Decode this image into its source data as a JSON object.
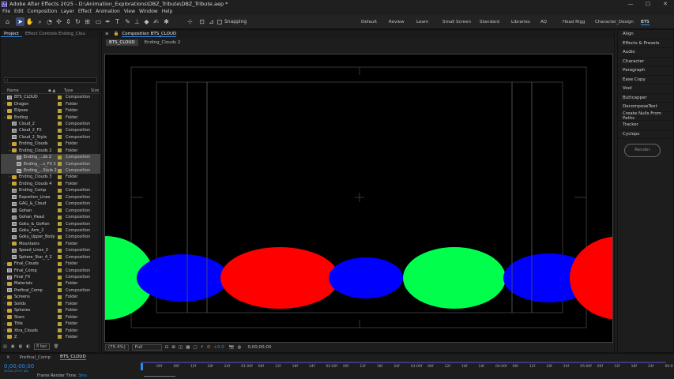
{
  "app": {
    "title": "Adobe After Effects 2025 - D:\\Animation_Explorations\\DBZ_Tribute\\DBZ_Tribute.aep *",
    "logo": "Ae",
    "window_controls": [
      "—",
      "☐",
      "✕"
    ]
  },
  "menu": [
    "File",
    "Edit",
    "Composition",
    "Layer",
    "Effect",
    "Animation",
    "View",
    "Window",
    "Help"
  ],
  "toolbar": {
    "snapping_label": "Snapping",
    "workspaces": [
      "Default",
      "Review",
      "Learn",
      "Small Screen",
      "Standard",
      "Libraries",
      "AQ",
      "Head Rigg",
      "Character_Design",
      "BTS"
    ],
    "active_workspace": "BTS"
  },
  "project": {
    "tabs": [
      "Project",
      "Effect Controls Ending_Clou"
    ],
    "search_placeholder": "",
    "columns": {
      "name": "Name",
      "type": "Type",
      "size": "Size"
    },
    "rows": [
      {
        "name": "BTS_CLOUD",
        "type": "Composition",
        "kind": "c",
        "indent": 0,
        "arrow": ""
      },
      {
        "name": "Dragon",
        "type": "Folder",
        "kind": "f",
        "indent": 0,
        "arrow": "›"
      },
      {
        "name": "Elipses",
        "type": "Folder",
        "kind": "f",
        "indent": 0,
        "arrow": "›"
      },
      {
        "name": "Ending",
        "type": "Folder",
        "kind": "f",
        "indent": 0,
        "arrow": "⌄"
      },
      {
        "name": "Cloud_2",
        "type": "Composition",
        "kind": "c",
        "indent": 1,
        "arrow": ""
      },
      {
        "name": "Cloud_2_FX",
        "type": "Composition",
        "kind": "c",
        "indent": 1,
        "arrow": ""
      },
      {
        "name": "Cloud_2_Style",
        "type": "Composition",
        "kind": "c",
        "indent": 1,
        "arrow": ""
      },
      {
        "name": "Ending_Clouds",
        "type": "Folder",
        "kind": "f",
        "indent": 1,
        "arrow": "›"
      },
      {
        "name": "Ending_Clouds 2",
        "type": "Folder",
        "kind": "f",
        "indent": 1,
        "arrow": "⌄"
      },
      {
        "name": "Ending_...ds 2",
        "type": "Composition",
        "kind": "c",
        "indent": 2,
        "arrow": "",
        "selected": true
      },
      {
        "name": "Ending_...s_FX 2",
        "type": "Composition",
        "kind": "c",
        "indent": 2,
        "arrow": "",
        "selected": true
      },
      {
        "name": "Ending_...Style 2",
        "type": "Composition",
        "kind": "c",
        "indent": 2,
        "arrow": "",
        "selected": true
      },
      {
        "name": "Ending_Clouds 3",
        "type": "Folder",
        "kind": "f",
        "indent": 1,
        "arrow": "›"
      },
      {
        "name": "Ending_Clouds 4",
        "type": "Folder",
        "kind": "f",
        "indent": 1,
        "arrow": "›"
      },
      {
        "name": "Ending_Comp",
        "type": "Composition",
        "kind": "c",
        "indent": 1,
        "arrow": ""
      },
      {
        "name": "Expretion_Lines",
        "type": "Composition",
        "kind": "c",
        "indent": 1,
        "arrow": ""
      },
      {
        "name": "GAG_&_Cloud",
        "type": "Composition",
        "kind": "c",
        "indent": 1,
        "arrow": ""
      },
      {
        "name": "Gohan",
        "type": "Composition",
        "kind": "c",
        "indent": 1,
        "arrow": ""
      },
      {
        "name": "Gohan_Head",
        "type": "Composition",
        "kind": "c",
        "indent": 1,
        "arrow": ""
      },
      {
        "name": "Goku_&_GoHan",
        "type": "Composition",
        "kind": "c",
        "indent": 1,
        "arrow": ""
      },
      {
        "name": "Goku_Arm_2",
        "type": "Composition",
        "kind": "c",
        "indent": 1,
        "arrow": ""
      },
      {
        "name": "Goku_Upper_Body",
        "type": "Composition",
        "kind": "c",
        "indent": 1,
        "arrow": ""
      },
      {
        "name": "Mountains",
        "type": "Folder",
        "kind": "f",
        "indent": 1,
        "arrow": "›"
      },
      {
        "name": "Speed_Lines_2",
        "type": "Composition",
        "kind": "c",
        "indent": 1,
        "arrow": ""
      },
      {
        "name": "Sphere_Star_4_2",
        "type": "Composition",
        "kind": "c",
        "indent": 1,
        "arrow": ""
      },
      {
        "name": "Final_Clouds",
        "type": "Folder",
        "kind": "f",
        "indent": 0,
        "arrow": "›"
      },
      {
        "name": "Final_Comp",
        "type": "Composition",
        "kind": "c",
        "indent": 0,
        "arrow": ""
      },
      {
        "name": "Final_FX",
        "type": "Composition",
        "kind": "c",
        "indent": 0,
        "arrow": ""
      },
      {
        "name": "Materials",
        "type": "Folder",
        "kind": "f",
        "indent": 0,
        "arrow": "›"
      },
      {
        "name": "Prefinal_Comp",
        "type": "Composition",
        "kind": "c",
        "indent": 0,
        "arrow": ""
      },
      {
        "name": "Screens",
        "type": "Folder",
        "kind": "f",
        "indent": 0,
        "arrow": "›"
      },
      {
        "name": "Solids",
        "type": "Folder",
        "kind": "f",
        "indent": 0,
        "arrow": "›"
      },
      {
        "name": "Spheres",
        "type": "Folder",
        "kind": "f",
        "indent": 0,
        "arrow": "›"
      },
      {
        "name": "Stars",
        "type": "Folder",
        "kind": "f",
        "indent": 0,
        "arrow": "›"
      },
      {
        "name": "Title",
        "type": "Folder",
        "kind": "f",
        "indent": 0,
        "arrow": "›"
      },
      {
        "name": "Xtra_Clouds",
        "type": "Folder",
        "kind": "f",
        "indent": 0,
        "arrow": "›"
      },
      {
        "name": "Z",
        "type": "Folder",
        "kind": "f",
        "indent": 0,
        "arrow": "›"
      }
    ],
    "bpc": "8 bpc"
  },
  "composition": {
    "panel_title": "Composition BTS_CLOUD",
    "tabs": [
      "BTS_CLOUD",
      "Ending_Clouds 2"
    ],
    "active_tab": "BTS_CLOUD",
    "zoom": "(75.4%)",
    "resolution": "Full",
    "timecode": "0;00;00;00",
    "exposure": "+0.0",
    "shapes": [
      {
        "color": "#00ff4c"
      },
      {
        "color": "#0000ff"
      },
      {
        "color": "#ff0000"
      },
      {
        "color": "#0000ff"
      },
      {
        "color": "#00ff4c"
      },
      {
        "color": "#0000ff"
      },
      {
        "color": "#ff0000"
      }
    ]
  },
  "right_panel": {
    "items": [
      "Align",
      "Effects & Presets",
      "Audio",
      "Character",
      "Paragraph",
      "Ease Copy",
      "Vool",
      "Buttcapper",
      "DecomposeText",
      "Create Nulls From Paths",
      "Tracker",
      "Cyclops"
    ],
    "render_button": "Render"
  },
  "timeline": {
    "tabs": [
      "Prefinal_Comp",
      "BTS_CLOUD"
    ],
    "active_tab": "BTS_CLOUD",
    "timecode": "0;00;00;00",
    "fps_info": "00000 (29.97 fps)",
    "frame_render_label": "Frame Render Time:",
    "frame_render_value": "3ms",
    "ruler": [
      "00f",
      "06f",
      "12f",
      "18f",
      "24f",
      "01:00f",
      "06f",
      "12f",
      "18f",
      "24f",
      "02:00f",
      "06f",
      "12f",
      "18f",
      "24f",
      "03:00f",
      "06f",
      "12f",
      "18f",
      "24f",
      "04:00f",
      "06f",
      "12f",
      "18f",
      "24f",
      "05:00f",
      "06f",
      "12f",
      "18f",
      "24f",
      "06:0"
    ]
  }
}
